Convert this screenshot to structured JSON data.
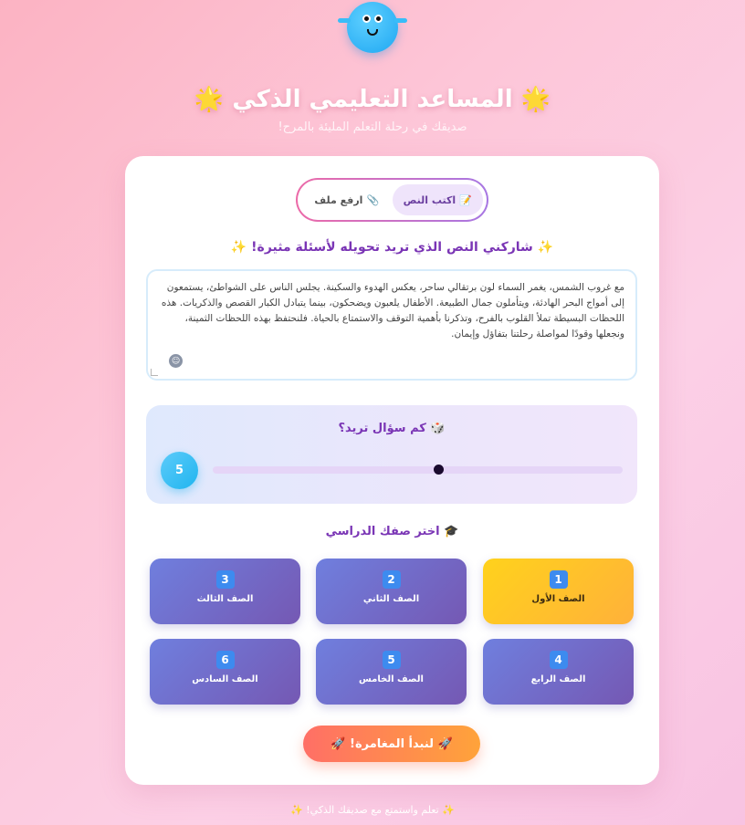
{
  "header": {
    "title": "المساعد التعليمي الذكي",
    "title_icon_left": "🌟",
    "title_icon_right": "🌟",
    "subtitle": "صديقك في رحلة التعلم المليئة بالمرح!"
  },
  "tabs": [
    {
      "label": "اكتب النص",
      "icon": "📝",
      "active": true
    },
    {
      "label": "ارفع ملف",
      "icon": "📎",
      "active": false
    }
  ],
  "prompt": "✨ شاركني النص الذي تريد تحويله لأسئلة مثيرة! ✨",
  "text_input": {
    "value": "مع غروب الشمس، يغمر السماء لون برتقالي ساحر، يعكس الهدوء والسكينة. يجلس الناس على الشواطئ، يستمعون إلى أمواج البحر الهادئة، ويتأملون جمال الطبيعة. الأطفال يلعبون ويضحكون، بينما يتبادل الكبار القصص والذكريات. هذه اللحظات البسيطة تملأ القلوب بالفرح، وتذكرنا بأهمية التوقف والاستمتاع بالحياة. فلنحتفظ بهذه اللحظات الثمينة، ونجعلها وقودًا لمواصلة رحلتنا بتفاؤل وإيمان."
  },
  "slider": {
    "title": "🎲 كم سؤال تريد؟",
    "value": "5",
    "min": 1,
    "max": 10,
    "position_fraction": 0.55
  },
  "grades": {
    "title": "🎓 اختر صفك الدراسي",
    "items": [
      {
        "num": "1",
        "label": "الصف الأول",
        "active": true
      },
      {
        "num": "2",
        "label": "الصف الثاني",
        "active": false
      },
      {
        "num": "3",
        "label": "الصف الثالث",
        "active": false
      },
      {
        "num": "4",
        "label": "الصف الرابع",
        "active": false
      },
      {
        "num": "5",
        "label": "الصف الخامس",
        "active": false
      },
      {
        "num": "6",
        "label": "الصف السادس",
        "active": false
      }
    ]
  },
  "cta": {
    "label": "🚀 لنبدأ المغامرة! 🚀"
  },
  "footer": "✨ تعلم واستمتع مع صديقك الذكي! ✨",
  "colors": {
    "accent": "#7a35b5",
    "active_grade": "#ffd21c",
    "cta_start": "#ff6f66",
    "cta_end": "#ffa33a"
  }
}
